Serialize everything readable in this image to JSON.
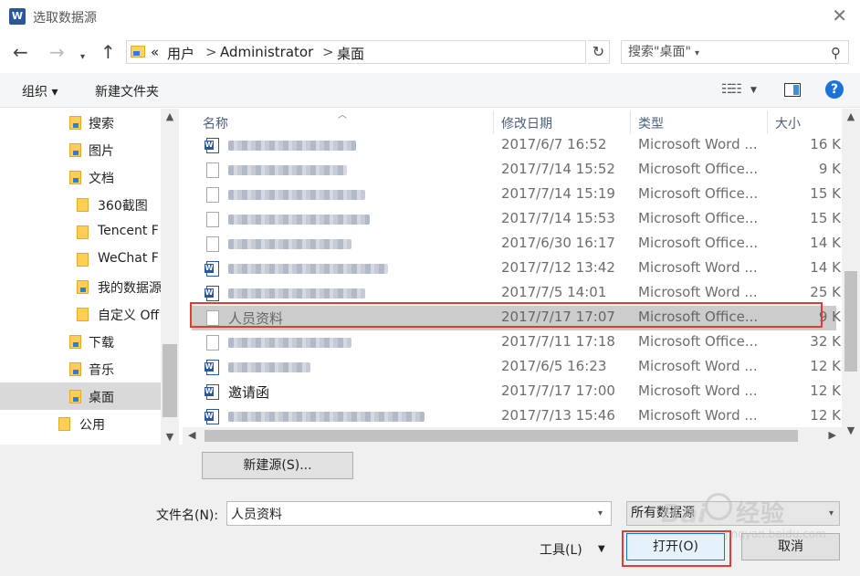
{
  "window": {
    "title": "选取数据源",
    "app_icon": "word-icon",
    "app_icon_letter": "W"
  },
  "address": {
    "overflow": "«",
    "parts": [
      "用户",
      "Administrator",
      "桌面"
    ],
    "separator": ">",
    "search_placeholder": "搜索\"桌面\""
  },
  "toolbar": {
    "organize": "组织 ▾",
    "new_folder": "新建文件夹"
  },
  "nav": {
    "items": [
      {
        "label": "搜索",
        "icon": "search-folder-icon"
      },
      {
        "label": "图片",
        "icon": "pictures-folder-icon"
      },
      {
        "label": "文档",
        "icon": "documents-folder-icon"
      },
      {
        "label": "360截图",
        "icon": "folder-icon"
      },
      {
        "label": "Tencent F",
        "icon": "folder-icon"
      },
      {
        "label": "WeChat F",
        "icon": "folder-icon"
      },
      {
        "label": "我的数据源",
        "icon": "data-source-folder-icon"
      },
      {
        "label": "自定义 Off",
        "icon": "folder-icon"
      },
      {
        "label": "下载",
        "icon": "downloads-folder-icon"
      },
      {
        "label": "音乐",
        "icon": "music-folder-icon"
      },
      {
        "label": "桌面",
        "icon": "desktop-folder-icon",
        "selected": true
      },
      {
        "label": "公用",
        "icon": "folder-icon"
      }
    ]
  },
  "columns": {
    "name": "名称",
    "modified": "修改日期",
    "type": "类型",
    "size": "大小"
  },
  "files": [
    {
      "name": "",
      "date": "2017/6/7 16:52",
      "type": "Microsoft Word ...",
      "size": "16 K",
      "icon": "word",
      "blur": 140
    },
    {
      "name": "",
      "date": "2017/7/14 15:52",
      "type": "Microsoft Office...",
      "size": "9 K",
      "icon": "doc",
      "blur": 130
    },
    {
      "name": "",
      "date": "2017/7/14 15:19",
      "type": "Microsoft Office...",
      "size": "15 K",
      "icon": "doc",
      "blur": 150
    },
    {
      "name": "",
      "date": "2017/7/14 15:53",
      "type": "Microsoft Office...",
      "size": "15 K",
      "icon": "doc",
      "blur": 155
    },
    {
      "name": "",
      "date": "2017/6/30 16:17",
      "type": "Microsoft Office...",
      "size": "14 K",
      "icon": "doc",
      "blur": 135
    },
    {
      "name": "",
      "date": "2017/7/12 13:42",
      "type": "Microsoft Word ...",
      "size": "14 K",
      "icon": "word",
      "blur": 175
    },
    {
      "name": "",
      "date": "2017/7/5 14:01",
      "type": "Microsoft Word ...",
      "size": "25 K",
      "icon": "word",
      "blur": 150
    },
    {
      "name": "人员资料",
      "date": "2017/7/17 17:07",
      "type": "Microsoft Office...",
      "size": "9 K",
      "icon": "doc",
      "selected": true
    },
    {
      "name": "",
      "date": "2017/7/11 17:18",
      "type": "Microsoft Office...",
      "size": "32 K",
      "icon": "doc",
      "blur": 135
    },
    {
      "name": "",
      "date": "2017/6/5 16:23",
      "type": "Microsoft Word ...",
      "size": "12 K",
      "icon": "word",
      "blur": 90
    },
    {
      "name": "邀请函",
      "date": "2017/7/17 17:00",
      "type": "Microsoft Word ...",
      "size": "12 K",
      "icon": "word"
    },
    {
      "name": "",
      "date": "2017/7/13 15:46",
      "type": "Microsoft Word ...",
      "size": "12 K",
      "icon": "word",
      "blur": 215
    }
  ],
  "bottom": {
    "new_source": "新建源(S)...",
    "filename_label": "文件名(N):",
    "filename_value": "人员资料",
    "filetype": "所有数据源",
    "tools": "工具(L)",
    "open": "打开(O)",
    "cancel": "取消"
  },
  "watermark": {
    "brand": "Bai",
    "text": "经验",
    "url": "jingyan.baidu.com"
  },
  "colors": {
    "highlight": "#e53935",
    "selection": "#cccccc",
    "accent": "#0078d7",
    "word_blue": "#2b579a",
    "folder": "#ffcf55"
  }
}
